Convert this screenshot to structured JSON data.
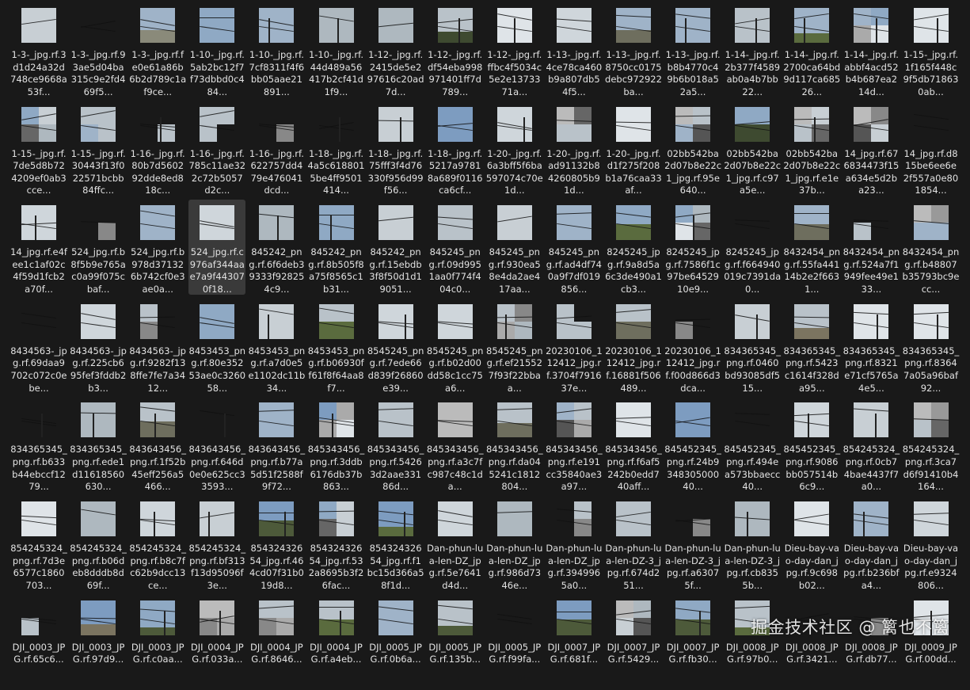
{
  "selected_file": "524_jpg.rf.c976af344aae7a9f443070f18...",
  "watermark": "掘金技术社区 @ 篱也不篱",
  "files": [
    [
      "1-3-_jpg.rf.3d1d24a32d748ce9668a53f...",
      "1-3-_jpg.rf.93ae5d04ba315c9e2fd469f5...",
      "1-3-_jpg.rf.fe0e61a86b6b2d789c1af9ce...",
      "1-10-_jpg.rf.5ab2bc12f7f73dbbd0c484...",
      "1-10-_jpg.rf.7cf8311f4f6bb05aae21891...",
      "1-10-_jpg.rf.44d489a56417b2cf41d1f9...",
      "1-12-_jpg.rf.2415de5e297616c20ad7d...",
      "1-12-_jpg.rf.df54eba998971401ff7d789...",
      "1-12-_jpg.rf.ffbc4f5034c5e2e1373371a...",
      "1-13-_jpg.rf.4ce78ca460b9a807db54f5...",
      "1-13-_jpg.rf.8750cc0175debc972922ba...",
      "1-13-_jpg.rf.b8b4770c49b6b018a52a5...",
      "1-14-_jpg.rf.2b377f4589ab0a4b7bb22...",
      "1-14-_jpg.rf.2700ca64bd9d117ca68526...",
      "1-14-_jpg.rf.abbf4acd52b4b687ea214d...",
      "1-15-_jpg.rf.1f165f448c9f5db718630ab..."
    ],
    [
      "1-15-_jpg.rf.7de5d8b724209ef0ab3cce...",
      "1-15-_jpg.rf.30443f13f022571bcbb84ffc...",
      "1-16-_jpg.rf.80b7d560292dde8ed818c...",
      "1-16-_jpg.rf.785c11ae322c72b5057d2c...",
      "1-16-_jpg.rf.622757dd479e476041dcd...",
      "1-18-_jpg.rf.4a5c6188015be4ff9501414...",
      "1-18-_jpg.rf.75fff3f4d76330f956d99f56...",
      "1-18-_jpg.rf.5217a97818a689f0116ca6cf...",
      "1-20-_jpg.rf.6a3bff5f6ba597074c70e1d...",
      "1-20-_jpg.rf.ad91132b84260805b91d...",
      "1-20-_jpg.rf.d1f275f208b1a76caa33af...",
      "02bb542ba2d07b8e22c1_jpg.rf.95e640...",
      "02bb542ba2d07b8e22c1_jpg.rf.c97a5e...",
      "02bb542ba2d07b8e22c1_jpg.rf.e1e37b...",
      "14_jpg.rf.676834473f15a634e5d2ba23...",
      "14_jpg.rf.d815be6ee6e2f557a0e801854..."
    ],
    [
      "14_jpg.rf.e4fee1c1af02c4f59d1fcb2a70f...",
      "524_jpg.rf.b8f5b9e765ac0a99f075cbaf...",
      "524_jpg.rf.b978d371326b742cf0e3ae0a...",
      "524_jpg.rf.c976af344aae7a9f443070f18...",
      "845242_png.rf.6f6deb39333f928254c9...",
      "845242_png.rf.8b505f8a75f8565c1b31...",
      "845242_png.rf.15ebdb3f8f50d1d19051...",
      "845245_png.rf.09d9951aa0f774f404c0...",
      "845245_png.rf.930ea58e4da2ae417aa...",
      "845245_png.rf.ad4df740a9f7df019856...",
      "8245245_jpg.rf.9a8d5a6c3de490a1cb3...",
      "8245245_jpg.rf.7586f1c97be6452910e9...",
      "8245245_jpg.rf.f664940019c7391da0...",
      "8432454_png.rf.55fa44114b2e2f6631...",
      "8432454_png.rf.524a7f1949fee49e133...",
      "8432454_png.rf.b48807b35793bc9ecc..."
    ],
    [
      "8434563-_jpg.rf.69daa9702c072c0ebe...",
      "8434563-_jpg.rf.225cb695fef3fddb2b3...",
      "8434563-_jpg.rf.9282f138ffe7fe7a3412...",
      "8453453_png.rf.80e35253ae0c326058...",
      "8453453_png.rf.a7d0e5e1102dc11b34...",
      "8453453_png.rf.b06930ff61f8f64aa8f7...",
      "8545245_png.rf.7ede66d839f26860e39...",
      "8545245_png.rf.b02d00dd58c1cc75a6...",
      "8545245_png.rf.ef215527f93f22bbaa...",
      "20230106_112412_jpg.rf.3704f791637e...",
      "20230106_112412_jpg.rf.16881f506489...",
      "20230106_112412_jpg.rf.f00d866d3dca...",
      "834365345_png.rf.0460bd93085df515...",
      "834365345_png.rf.5423c1614f328da95...",
      "834365345_png.rf.8321e71cf5765a4e5...",
      "834365345_png.rf.83647a05a96baf92..."
    ],
    [
      "834365345_png.rf.b633b44ebccf1279...",
      "834365345_png.rf.ede1d11618560630...",
      "843643456_png.rf.1f52b45eff256a5466...",
      "843643456_png.rf.646d0e0e625cc33593...",
      "843643456_png.rf.b77a5d51f2588f9f72...",
      "845343456_png.rf.3ddb6176db37b863...",
      "845343456_png.rf.54263d2aae33186d...",
      "845343456_png.rf.a3c7fc987c48c1da...",
      "845343456_png.rf.da045241c1812804...",
      "845343456_png.rf.e191cc35840ae3a97...",
      "845343456_png.rf.f6af5242b0edd740aff...",
      "845452345_png.rf.24b934830500040...",
      "845452345_png.rf.494ea573bbaecc40...",
      "845452345_png.rf.9086bb057514b6c9...",
      "854245324_png.rf.0cb74bae4437f7a0...",
      "854245324_png.rf.3ca7d6f91410b4164..."
    ],
    [
      "854245324_png.rf.7d3e6577c1860703...",
      "854245324_png.rf.b06deb8dddb8d69f...",
      "854245324_png.rf.b8c7fc62b9dcc13ce...",
      "854245324_png.rf.bf313f13d95096f3e...",
      "854324326 54_jpg.rf.464cd07f31b019d8...",
      "854324326 54_jpg.rf.532a8695b3f26fac...",
      "854324326 54_jpg.rf.f1bc15d366a58f1d...",
      "Dan-phun-lua-len-DZ_jpg.rf.5e7641d4d...",
      "Dan-phun-lua-len-DZ_jpg.rf.986d7346e...",
      "Dan-phun-lua-len-DZ_jpg.rf.3949965a0...",
      "Dan-phun-lua-len-DZ-3_jpg.rf.674d251...",
      "Dan-phun-lua-len-DZ-3_jpg.rf.a63075f...",
      "Dan-phun-lua-len-DZ-3_jpg.rf.cb8355b...",
      "Dieu-bay-vao-day-dan_jpg.rf.9c698b02...",
      "Dieu-bay-vao-day-dan_jpg.rf.b236bfa4...",
      "Dieu-bay-vao-day-dan_jpg.rf.e9324806..."
    ],
    [
      "DJI_0003_JPG.rf.65c6...",
      "DJI_0003_JPG.rf.97d9...",
      "DJI_0003_JPG.rf.c0aa...",
      "DJI_0004_JPG.rf.033a...",
      "DJI_0004_JPG.rf.8646...",
      "DJI_0004_JPG.rf.a4eb...",
      "DJI_0005_JPG.rf.0b6a...",
      "DJI_0005_JPG.rf.135b...",
      "DJI_0005_JPG.rf.f99fa...",
      "DJI_0007_JPG.rf.681f...",
      "DJI_0007_JPG.rf.5429...",
      "DJI_0007_JPG.rf.fb30...",
      "DJI_0008_JPG.rf.97b0...",
      "DJI_0008_JPG.rf.3421...",
      "DJI_0008_JPG.rf.db77...",
      "DJI_0009_JPG.rf.00dd..."
    ]
  ]
}
